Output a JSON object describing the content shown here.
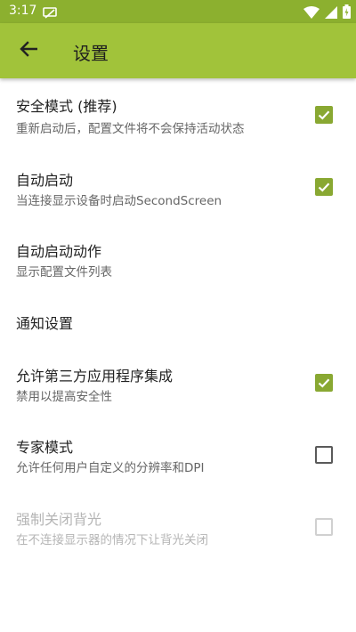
{
  "status_bar": {
    "time": "3:17",
    "icons": [
      "notification-icon",
      "wifi-icon",
      "signal-icon",
      "battery-icon"
    ]
  },
  "toolbar": {
    "title": "设置",
    "back_icon": "arrow-back-icon"
  },
  "colors": {
    "status_bar": "#8cb02f",
    "toolbar": "#a1c33a",
    "checkbox_checked": "#89a832"
  },
  "settings": [
    {
      "title": "安全模式 (推荐)",
      "summary": "重新启动后，配置文件将不会保持活动状态",
      "checked": true,
      "enabled": true
    },
    {
      "title": "自动启动",
      "summary": "当连接显示设备时启动SecondScreen",
      "checked": true,
      "enabled": true
    },
    {
      "title": "自动启动动作",
      "summary": "显示配置文件列表"
    },
    {
      "title": "通知设置"
    },
    {
      "title": "允许第三方应用程序集成",
      "summary": "禁用以提高安全性",
      "checked": true,
      "enabled": true
    },
    {
      "title": "专家模式",
      "summary": "允许任何用户自定义的分辨率和DPI",
      "checked": false,
      "enabled": true
    },
    {
      "title": "强制关闭背光",
      "summary": "在不连接显示器的情况下让背光关闭",
      "checked": false,
      "enabled": false
    }
  ]
}
